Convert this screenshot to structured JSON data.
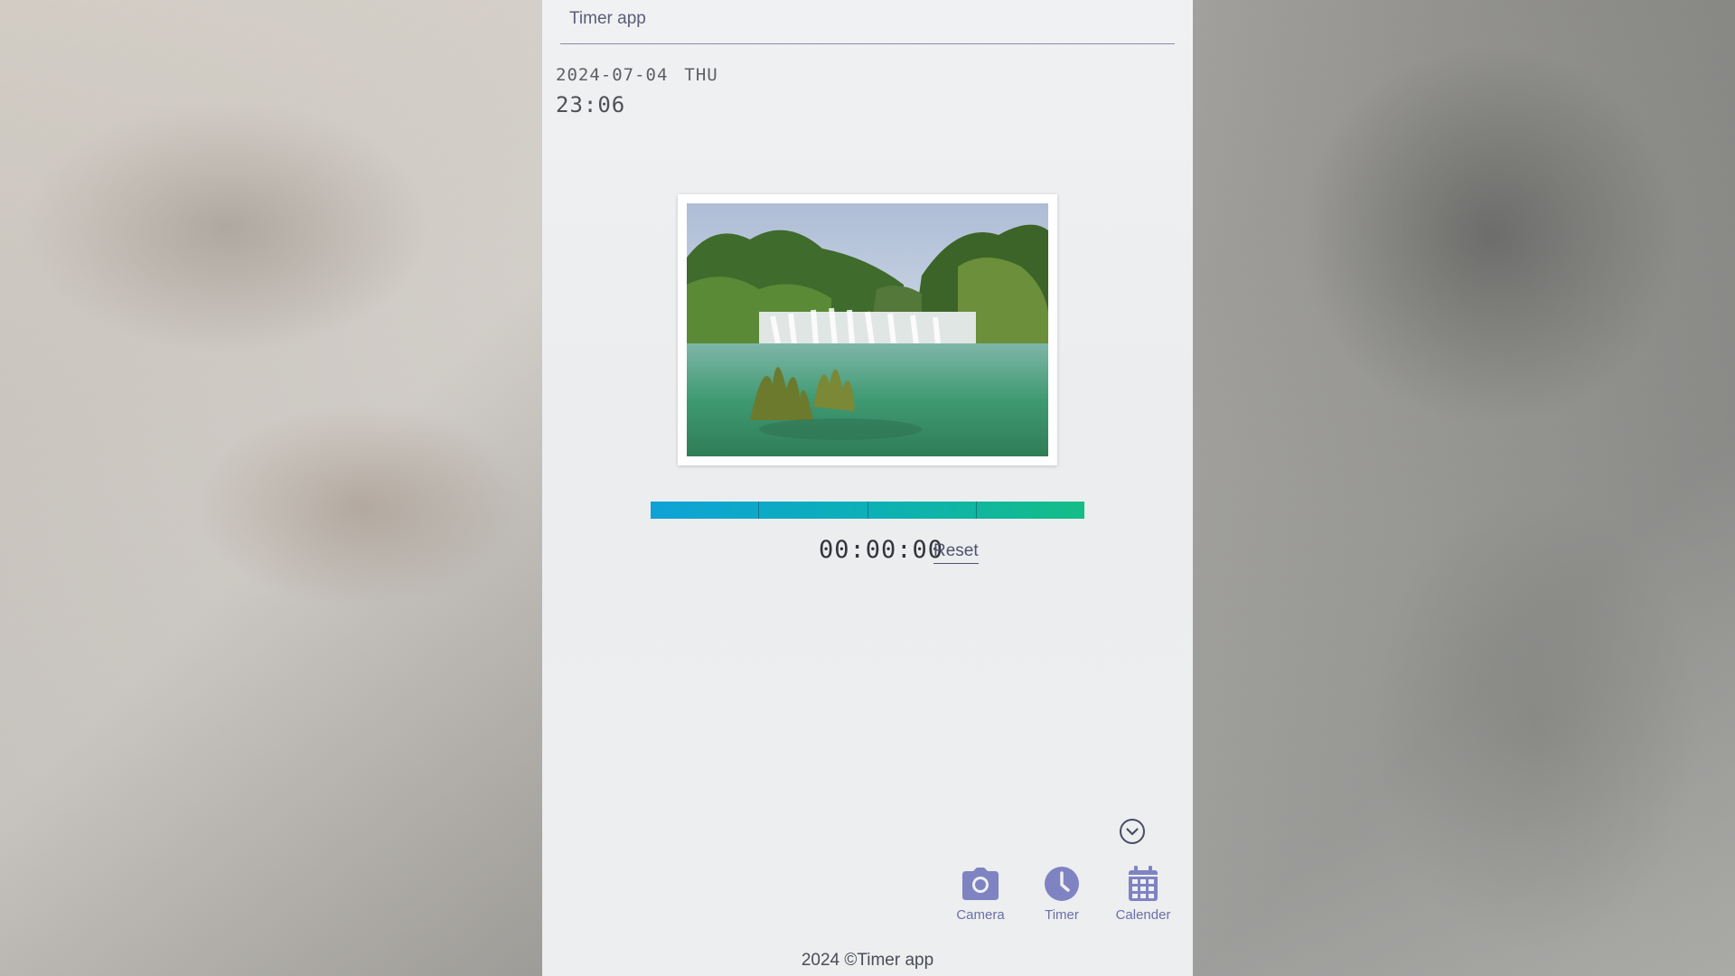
{
  "header": {
    "title": "Timer app"
  },
  "clock": {
    "date": "2024-07-04",
    "weekday": "THU",
    "time": "23:06"
  },
  "timer": {
    "elapsed": "00:00:00",
    "reset_label": "Reset",
    "progress": 1.0,
    "progress_segments": 4
  },
  "nav": {
    "items": [
      {
        "label": "Camera",
        "icon": "camera-icon"
      },
      {
        "label": "Timer",
        "icon": "clock-icon"
      },
      {
        "label": "Calender",
        "icon": "calendar-icon"
      }
    ]
  },
  "footer": {
    "text": "2024 ©Timer app"
  },
  "colors": {
    "accent": "#7f83c2",
    "progress_start": "#0ea2d6",
    "progress_end": "#14bd86",
    "text_dark": "#33353d"
  }
}
